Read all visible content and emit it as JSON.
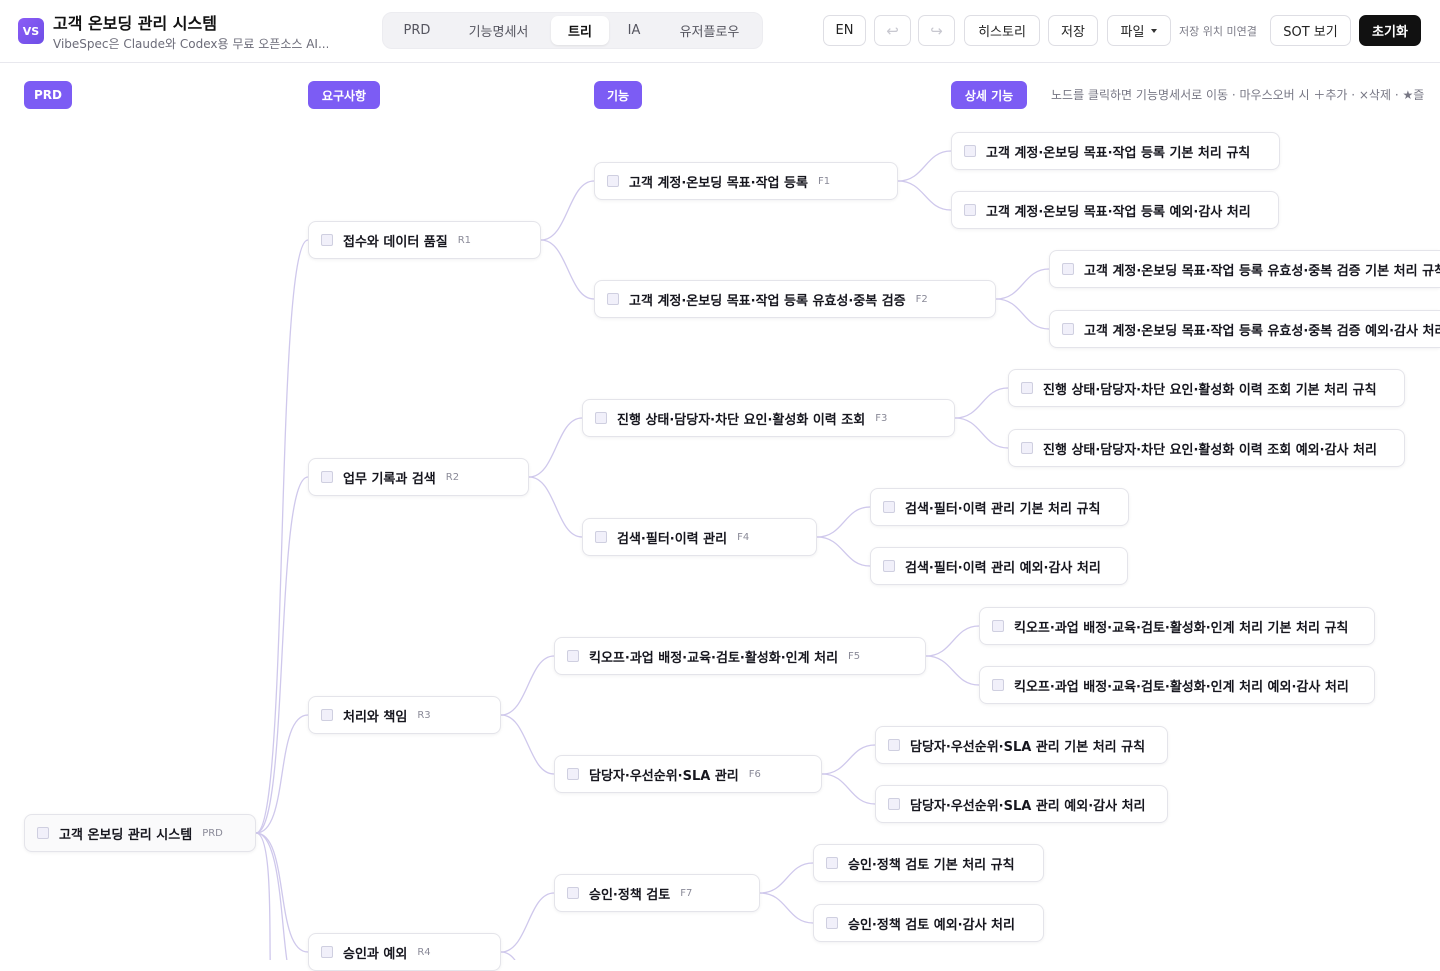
{
  "app": {
    "logo": "VS",
    "title": "고객 온보딩 관리 시스템",
    "subtitle": "VibeSpec은 Claude와 Codex용 무료 오픈소스 AI..."
  },
  "tabs": [
    {
      "label": "PRD",
      "active": false
    },
    {
      "label": "기능명세서",
      "active": false
    },
    {
      "label": "트리",
      "active": true
    },
    {
      "label": "IA",
      "active": false
    },
    {
      "label": "유저플로우",
      "active": false
    }
  ],
  "toolbar": {
    "lang": "EN",
    "undo_icon": "undo-icon",
    "redo_icon": "redo-icon",
    "undo_glyph": "↩",
    "redo_glyph": "↪",
    "history": "히스토리",
    "save": "저장",
    "file": "파일",
    "save_location": "저장 위치 미연결",
    "sot": "SOT 보기",
    "reset": "초기화"
  },
  "columns": {
    "prd": "PRD",
    "requirements": "요구사항",
    "features": "기능",
    "details": "상세 기능"
  },
  "hint": "노드를 클릭하면 기능명세서로 이동 · 마우스오버 시 ＋추가 · ×삭제 · ★즐",
  "colors": {
    "accent": "#7c5cf4",
    "edge": "#cfc8ec",
    "dark_button": "#111111"
  },
  "tree": {
    "root": {
      "label": "고객 온보딩 관리 시스템",
      "code": "PRD"
    },
    "requirements": [
      {
        "label": "접수와 데이터 품질",
        "code": "R1"
      },
      {
        "label": "업무 기록과 검색",
        "code": "R2"
      },
      {
        "label": "처리와 책임",
        "code": "R3"
      },
      {
        "label": "승인과 예외",
        "code": "R4"
      }
    ],
    "features": [
      {
        "label": "고객 계정·온보딩 목표·작업 등록",
        "code": "F1"
      },
      {
        "label": "고객 계정·온보딩 목표·작업 등록 유효성·중복 검증",
        "code": "F2"
      },
      {
        "label": "진행 상태·담당자·차단 요인·활성화 이력 조회",
        "code": "F3"
      },
      {
        "label": "검색·필터·이력 관리",
        "code": "F4"
      },
      {
        "label": "킥오프·과업 배정·교육·검토·활성화·인계 처리",
        "code": "F5"
      },
      {
        "label": "담당자·우선순위·SLA 관리",
        "code": "F6"
      },
      {
        "label": "승인·정책 검토",
        "code": "F7"
      }
    ],
    "details": [
      {
        "label": "고객 계정·온보딩 목표·작업 등록 기본 처리 규칙"
      },
      {
        "label": "고객 계정·온보딩 목표·작업 등록 예외·감사 처리"
      },
      {
        "label": "고객 계정·온보딩 목표·작업 등록 유효성·중복 검증 기본 처리 규칙"
      },
      {
        "label": "고객 계정·온보딩 목표·작업 등록 유효성·중복 검증 예외·감사 처리"
      },
      {
        "label": "진행 상태·담당자·차단 요인·활성화 이력 조회 기본 처리 규칙"
      },
      {
        "label": "진행 상태·담당자·차단 요인·활성화 이력 조회 예외·감사 처리"
      },
      {
        "label": "검색·필터·이력 관리 기본 처리 규칙"
      },
      {
        "label": "검색·필터·이력 관리 예외·감사 처리"
      },
      {
        "label": "킥오프·과업 배정·교육·검토·활성화·인계 처리 기본 처리 규칙"
      },
      {
        "label": "킥오프·과업 배정·교육·검토·활성화·인계 처리 예외·감사 처리"
      },
      {
        "label": "담당자·우선순위·SLA 관리 기본 처리 규칙"
      },
      {
        "label": "담당자·우선순위·SLA 관리 예외·감사 처리"
      },
      {
        "label": "승인·정책 검토 기본 처리 규칙"
      },
      {
        "label": "승인·정책 검토 예외·감사 처리"
      }
    ]
  }
}
